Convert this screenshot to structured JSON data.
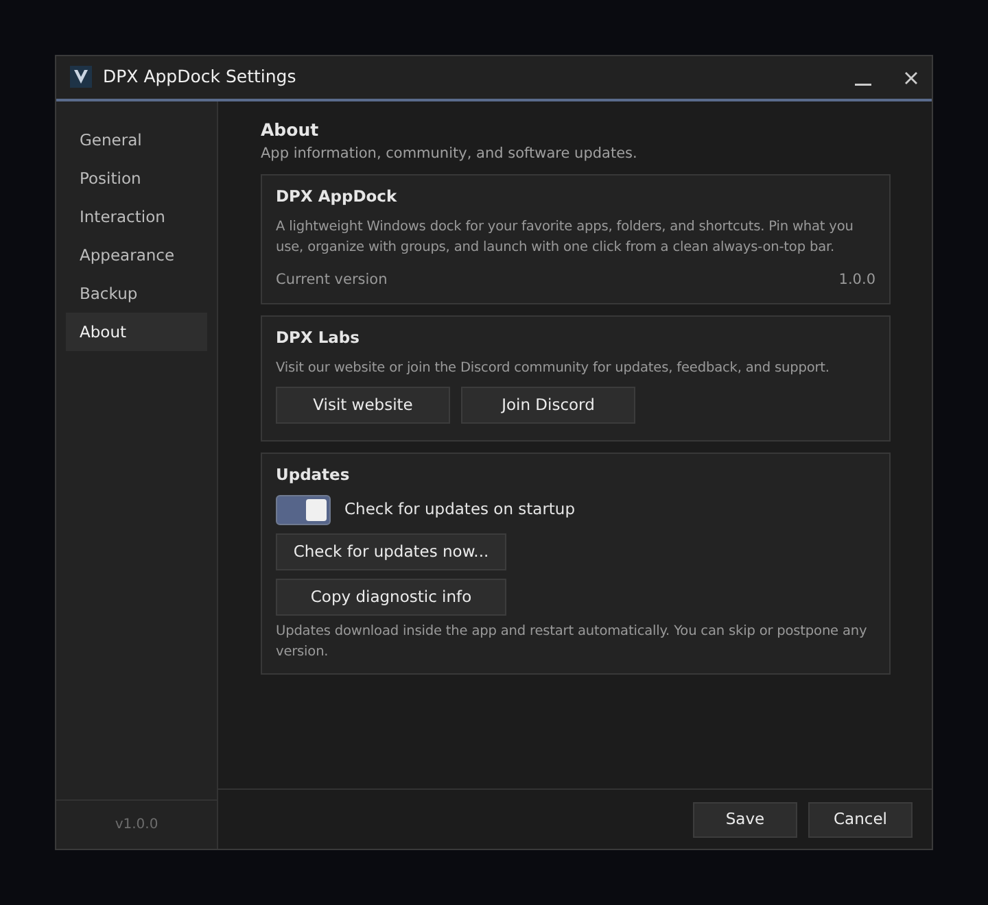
{
  "window": {
    "title": "DPX AppDock Settings"
  },
  "sidebar": {
    "items": [
      {
        "label": "General",
        "selected": false
      },
      {
        "label": "Position",
        "selected": false
      },
      {
        "label": "Interaction",
        "selected": false
      },
      {
        "label": "Appearance",
        "selected": false
      },
      {
        "label": "Backup",
        "selected": false
      },
      {
        "label": "About",
        "selected": true
      }
    ],
    "version": "v1.0.0"
  },
  "page": {
    "title": "About",
    "subtitle": "App information, community, and software updates.",
    "sections": [
      {
        "title": "DPX AppDock",
        "items": [
          {
            "kind": "text",
            "text": "A lightweight Windows dock for your favorite apps, folders, and shortcuts. Pin what you use, organize with groups, and launch with one click from a clean always-on-top bar."
          },
          {
            "kind": "value_row",
            "label": "Current version",
            "value": "1.0.0"
          }
        ]
      },
      {
        "title": "DPX Labs",
        "items": [
          {
            "kind": "text",
            "text": "Visit our website or join the Discord community for updates, feedback, and support."
          },
          {
            "kind": "buttons",
            "buttons": [
              "Visit website",
              "Join Discord"
            ]
          }
        ]
      },
      {
        "title": "Updates",
        "items": [
          {
            "kind": "toggle",
            "label": "Check for updates on startup",
            "on": true
          },
          {
            "kind": "buttons",
            "buttons": [
              "Check for updates now..."
            ]
          },
          {
            "kind": "buttons",
            "buttons": [
              "Copy diagnostic info"
            ]
          },
          {
            "kind": "text",
            "text": "Updates download inside the app and restart automatically. You can skip or postpone any version."
          }
        ]
      }
    ]
  },
  "footer": {
    "buttons": [
      "Save",
      "Cancel"
    ]
  }
}
